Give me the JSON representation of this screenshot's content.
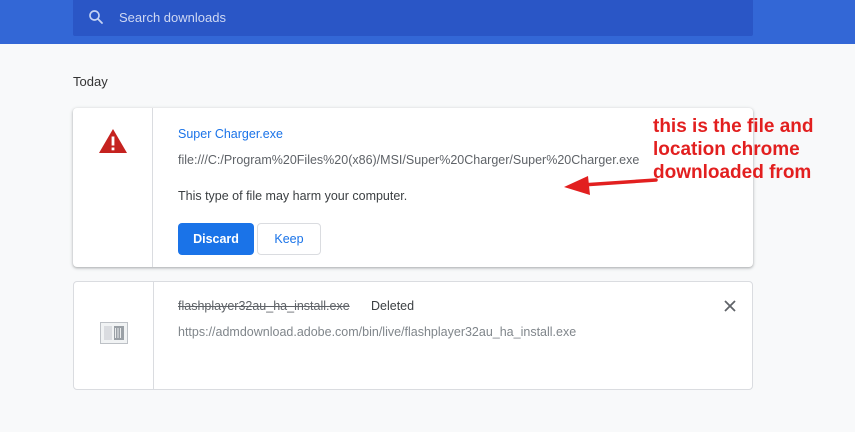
{
  "search": {
    "placeholder": "Search downloads",
    "icon": "search-icon"
  },
  "section": {
    "date_label": "Today"
  },
  "downloads": [
    {
      "icon": "warning-icon",
      "file_name": "Super Charger.exe",
      "url": "file:///C:/Program%20Files%20(x86)/MSI/Super%20Charger/Super%20Charger.exe",
      "warning": "This type of file may harm your computer.",
      "discard_label": "Discard",
      "keep_label": "Keep"
    },
    {
      "icon": "file-icon",
      "file_name": "flashplayer32au_ha_install.exe",
      "status": "Deleted",
      "url": "https://admdownload.adobe.com/bin/live/flashplayer32au_ha_install.exe"
    }
  ],
  "annotation": {
    "lines": [
      "this is the file and",
      "location chrome",
      "downloaded from"
    ],
    "color": "#e21f1f"
  },
  "colors": {
    "header": "#3367d6",
    "search_bg": "#2a56c6",
    "accent": "#1a73e8",
    "warning": "#c5221f"
  }
}
